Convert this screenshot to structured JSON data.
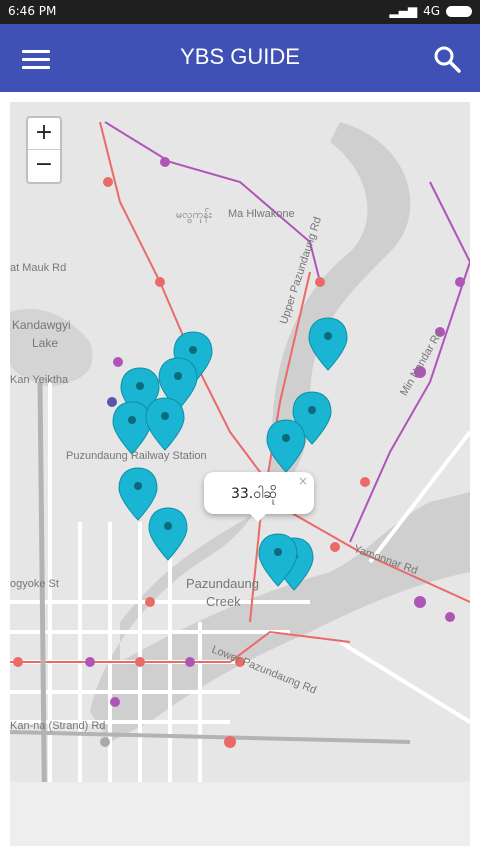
{
  "status": {
    "time": "6:46 PM",
    "network": "4G"
  },
  "app_bar": {
    "title": "YBS GUIDE",
    "menu_icon": "hamburger-menu-icon",
    "search_icon": "search-icon"
  },
  "zoom": {
    "in_label": "+",
    "out_label": "−"
  },
  "popup": {
    "text": "33.ဝါဆို",
    "close": "×"
  },
  "map_labels": {
    "ma_hlwakone": "Ma Hlwakone",
    "ma_hlwakone_local": "မလွကုန်း",
    "mauk_rd": "at Mauk Rd",
    "kandawgyi": "Kandawgyi",
    "lake": "Lake",
    "kan_yeiktha": "Kan Yeiktha",
    "pazundaung_station": "Puzundaung Railway Station",
    "upper_pazundaung": "Upper Pazundaung Rd",
    "yamonnar": "Yamonnar Rd",
    "pazundaung": "Pazundaung",
    "creek": "Creek",
    "lower_pazundaung": "Lower Pazundaung Rd",
    "bogyoke": "ogyoke St",
    "kanna": "Kan-na (Strand) Rd",
    "min_nandar": "Min Nandar Rd"
  },
  "colors": {
    "accent": "#3f51b5",
    "marker": "#19b5d2",
    "route": "#ea6a6a",
    "route_alt": "#b055b8",
    "water": "#c9c9c9"
  }
}
